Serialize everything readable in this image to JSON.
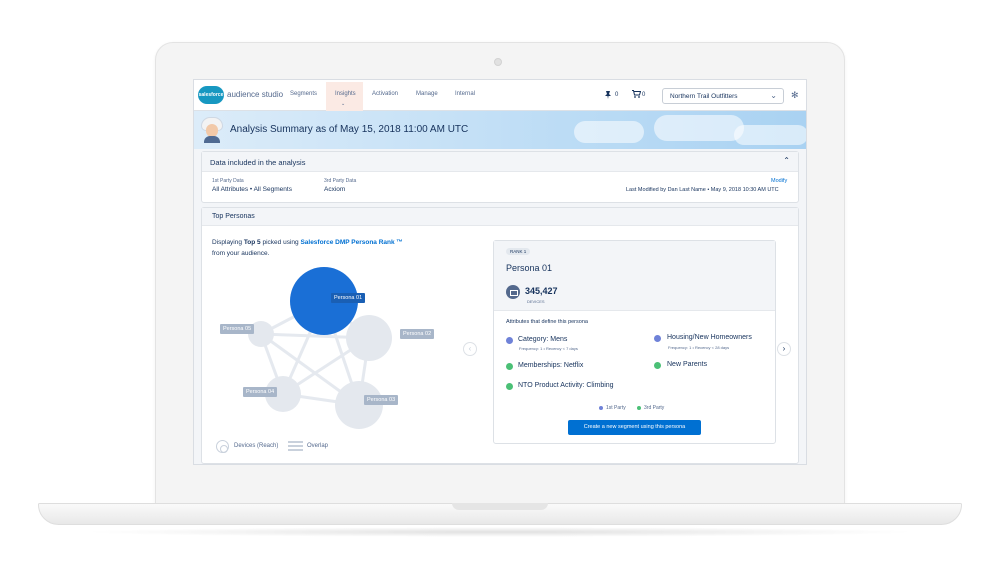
{
  "app": {
    "logo_text": "salesforce",
    "name": "audience studio"
  },
  "nav": {
    "tabs": [
      {
        "label": "Segments"
      },
      {
        "label": "Insights"
      },
      {
        "label": "Activation"
      },
      {
        "label": "Manage"
      },
      {
        "label": "Internal"
      }
    ],
    "active_tab": "Insights",
    "pinned_count": "0",
    "cart_count": "0",
    "org_select": "Northern Trail Outfitters"
  },
  "banner": {
    "title": "Analysis Summary as of May 15, 2018 11:00 AM UTC"
  },
  "data_included": {
    "title": "Data included in the analysis",
    "first_party_label": "1st Party Data",
    "first_party_value": "All Attributes • All Segments",
    "third_party_label": "3rd Party Data",
    "third_party_value": "Acxiom",
    "modify_link": "Modify",
    "last_modified": "Last Modified by Dan Last Name • May 9, 2018 10:30 AM UTC"
  },
  "top_personas": {
    "title": "Top Personas",
    "intro_prefix": "Displaying",
    "intro_bold": "Top 5",
    "intro_mid": "picked using",
    "intro_brand": "Salesforce DMP Persona Rank ™",
    "intro_suffix": "from your audience.",
    "bubbles": [
      {
        "label": "Persona 01",
        "selected": true
      },
      {
        "label": "Persona 02",
        "selected": false
      },
      {
        "label": "Persona 03",
        "selected": false
      },
      {
        "label": "Persona 04",
        "selected": false
      },
      {
        "label": "Persona 05",
        "selected": false
      }
    ],
    "legend_devices": "Devices (Reach)",
    "legend_overlap": "Overlap"
  },
  "persona_detail": {
    "rank": "RANK 1",
    "name": "Persona 01",
    "devices_count": "345,427",
    "devices_label": "DEVICES",
    "attributes_label": "Attributes that define this persona",
    "attributes": [
      {
        "label": "Category: Mens",
        "sub": "Frequency: 1  •  Recency < 7 days",
        "party": "1st"
      },
      {
        "label": "Housing/New Homeowners",
        "sub": "Frequency: 1  •  Recency < 28 days",
        "party": "1st"
      },
      {
        "label": "Memberships: Netflix",
        "sub": "",
        "party": "3rd"
      },
      {
        "label": "New Parents",
        "sub": "",
        "party": "3rd"
      },
      {
        "label": "NTO Product Activity: Climbing",
        "sub": "",
        "party": "3rd"
      }
    ],
    "legend_first": "1st Party",
    "legend_third": "3rd Party",
    "create_button": "Create a new segment using this persona"
  },
  "colors": {
    "brand_blue": "#0070d2",
    "first_party": "#6f82d8",
    "third_party": "#4bc076",
    "selected_bubble": "#1a6fd6",
    "bubble": "#e4e8ee"
  }
}
